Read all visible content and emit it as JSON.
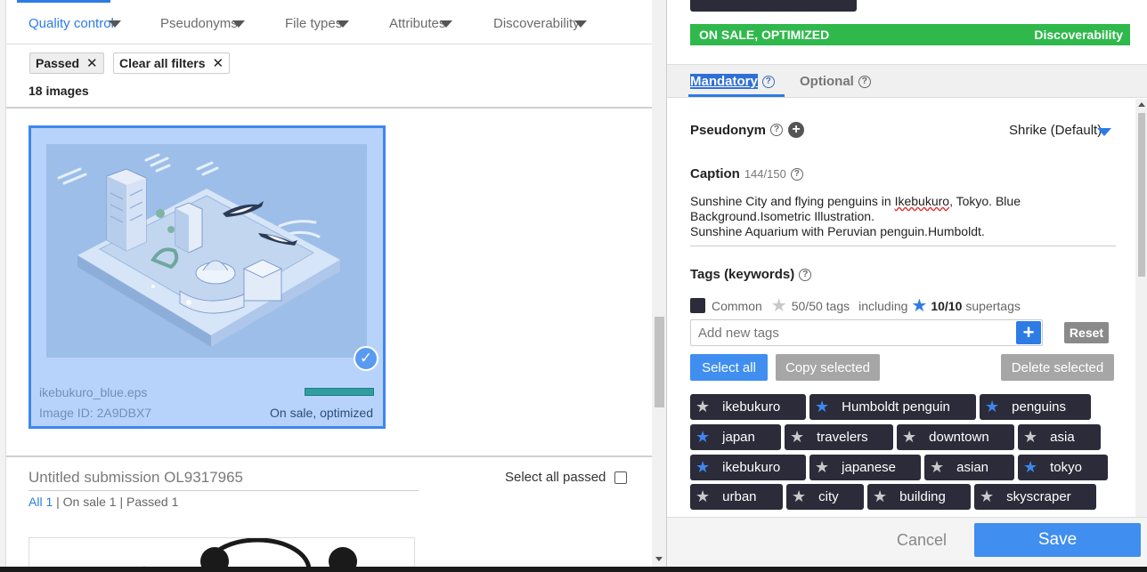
{
  "filters": {
    "tabs": [
      {
        "label": "Quality control",
        "active": true
      },
      {
        "label": "Pseudonyms",
        "active": false
      },
      {
        "label": "File types",
        "active": false
      },
      {
        "label": "Attributes",
        "active": false
      },
      {
        "label": "Discoverability",
        "active": false
      }
    ],
    "chips": [
      {
        "label": "Passed",
        "close": "✕"
      },
      {
        "label": "Clear all filters",
        "close": "✕"
      }
    ],
    "count_label": "18 images"
  },
  "card": {
    "filename": "ikebukuro_blue.eps",
    "image_id": "Image ID: 2A9DBX7",
    "status": "On sale, optimized",
    "check": "✓",
    "selected": true
  },
  "submission": {
    "title": "Untitled submission OL9317965",
    "select_all_passed": "Select all passed",
    "all": "All 1",
    "on_sale": "On sale 1",
    "passed": "Passed 1",
    "separator": "|"
  },
  "panel": {
    "status_bar": {
      "left": "ON SALE, OPTIMIZED",
      "right": "Discoverability",
      "color": "#2fb84b"
    },
    "tabs": {
      "mandatory": "Mandatory",
      "optional": "Optional",
      "help": "?"
    },
    "pseudonym": {
      "label": "Pseudonym",
      "value": "Shrike (Default)",
      "add": "+"
    },
    "caption": {
      "label": "Caption",
      "count": "144/150",
      "pre": "Sunshine City and flying penguins in ",
      "misspelled": "Ikebukuro",
      "post": ", Tokyo. Blue",
      "line2": "Background.Isometric Illustration.",
      "line3": "Sunshine Aquarium with Peruvian penguin.Humboldt."
    },
    "tags": {
      "label": "Tags (keywords)",
      "common": "Common",
      "tag_count": "50/50 tags",
      "including": "including",
      "supertag_count": "10/10",
      "supertags_word": "supertags",
      "add_placeholder": "Add new tags",
      "add_button": "+",
      "reset": "Reset",
      "select_all": "Select all",
      "copy_selected": "Copy selected",
      "delete_selected": "Delete selected",
      "items": [
        {
          "label": "ikebukuro",
          "super": false
        },
        {
          "label": "Humboldt penguin",
          "super": true
        },
        {
          "label": "penguins",
          "super": true
        },
        {
          "label": "japan",
          "super": true
        },
        {
          "label": "travelers",
          "super": false
        },
        {
          "label": "downtown",
          "super": false
        },
        {
          "label": "asia",
          "super": false
        },
        {
          "label": "ikebukuro",
          "super": true
        },
        {
          "label": "japanese",
          "super": false
        },
        {
          "label": "asian",
          "super": false
        },
        {
          "label": "tokyo",
          "super": true
        },
        {
          "label": "urban",
          "super": false
        },
        {
          "label": "city",
          "super": false
        },
        {
          "label": "building",
          "super": false
        },
        {
          "label": "skyscraper",
          "super": false
        }
      ]
    },
    "footer": {
      "cancel": "Cancel",
      "save": "Save"
    }
  },
  "colors": {
    "accent": "#2d7be5",
    "tag_bg": "#2b2b3a",
    "supertag_star": "#3d87ef",
    "success": "#2fb84b"
  },
  "icons": {
    "star": "★",
    "close": "✕"
  }
}
